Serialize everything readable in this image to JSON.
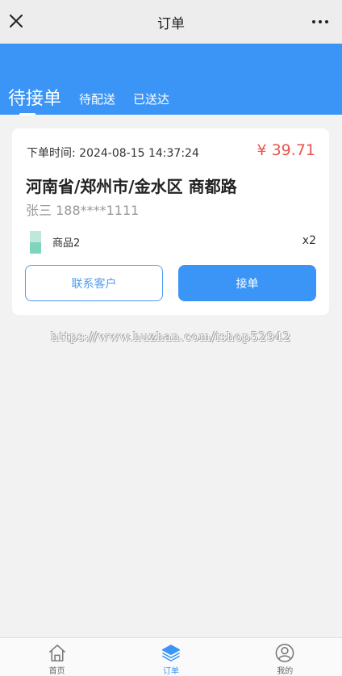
{
  "topbar": {
    "title": "订单",
    "close_icon": "close-icon",
    "more_icon": "more-icon"
  },
  "tabs": [
    {
      "label": "待接单",
      "active": true
    },
    {
      "label": "待配送",
      "active": false
    },
    {
      "label": "已送达",
      "active": false
    }
  ],
  "order": {
    "time": "下单时间: 2024-08-15 14:37:24",
    "price": "¥ 39.71",
    "address": "河南省/郑州市/金水区 商都路",
    "contact": "张三 188****1111",
    "goods_name": "商品2",
    "goods_qty": "x2",
    "contact_button": "联系客户",
    "accept_button": "接单"
  },
  "watermark": "https://www.huzhan.com/ishop52942",
  "nav": [
    {
      "label": "首页",
      "icon": "home-icon",
      "active": false
    },
    {
      "label": "订单",
      "icon": "layers-icon",
      "active": true
    },
    {
      "label": "我的",
      "icon": "user-icon",
      "active": false
    }
  ],
  "colors": {
    "accent": "#3b95f7",
    "price": "#e8554e",
    "thumb_light": "#bfe8dd",
    "thumb_dark": "#7fd4be"
  }
}
